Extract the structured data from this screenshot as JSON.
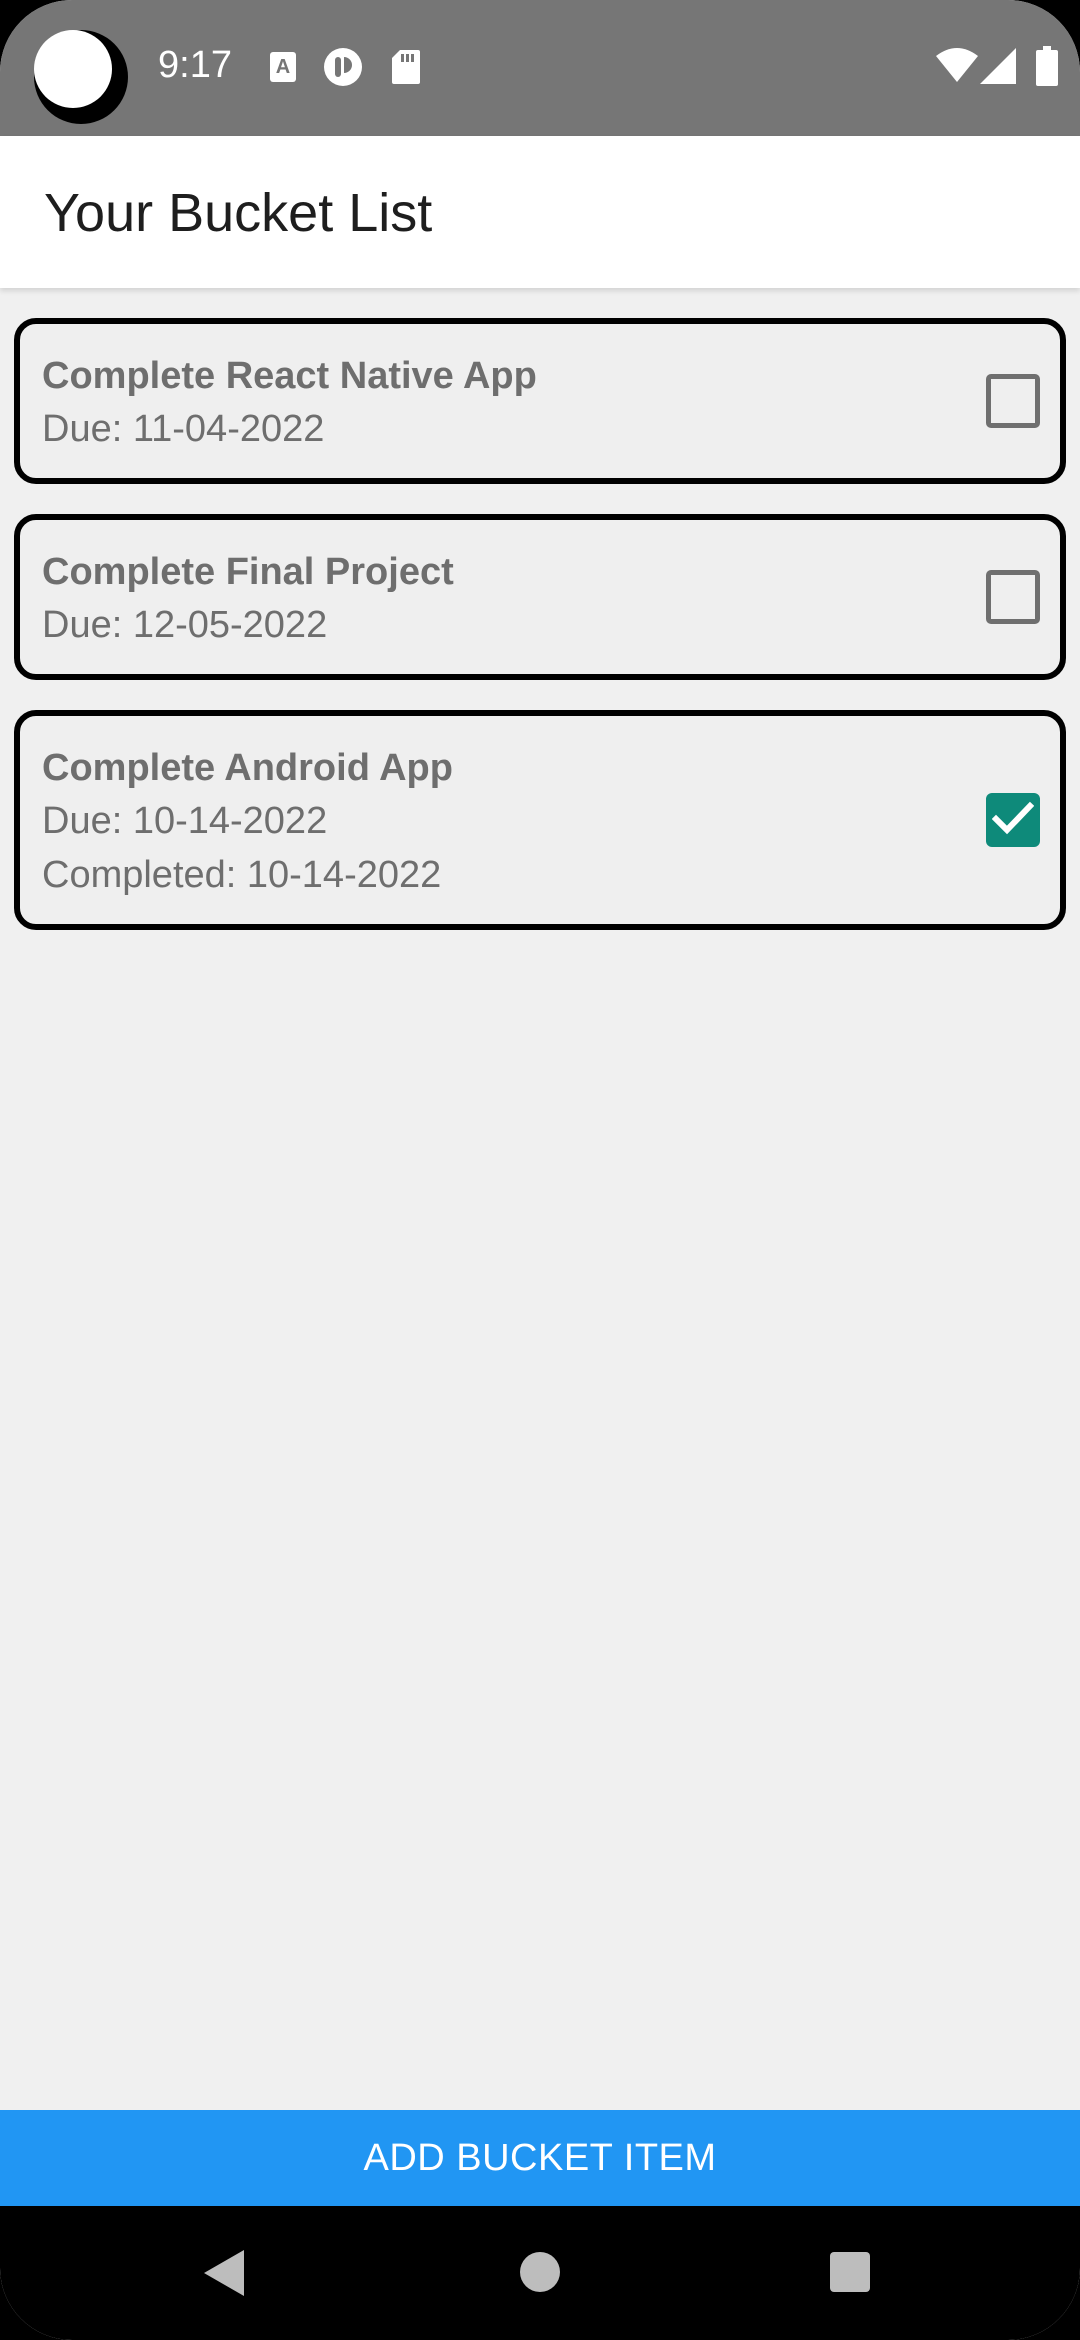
{
  "status_bar": {
    "time": "9:17",
    "icons": [
      "camera-icon",
      "keyboard-a-icon",
      "app-t-icon",
      "sd-card-icon",
      "wifi-icon",
      "signal-icon",
      "battery-icon"
    ]
  },
  "app_bar": {
    "title": "Your Bucket List"
  },
  "items": [
    {
      "title": "Complete React Native App",
      "due": "Due: 11-04-2022",
      "completed_text": "",
      "checked": false
    },
    {
      "title": "Complete Final Project",
      "due": "Due: 12-05-2022",
      "completed_text": "",
      "checked": false
    },
    {
      "title": "Complete Android App",
      "due": "Due: 10-14-2022",
      "completed_text": "Completed: 10-14-2022",
      "checked": true
    }
  ],
  "add_button": {
    "label": "ADD BUCKET ITEM"
  },
  "nav_bar": {
    "icons": [
      "back-icon",
      "home-icon",
      "recents-icon"
    ]
  },
  "colors": {
    "status_bar": "#767676",
    "accent_button": "#2196f3",
    "checkbox_checked": "#0e8a7a",
    "background": "#f0f0f0"
  }
}
